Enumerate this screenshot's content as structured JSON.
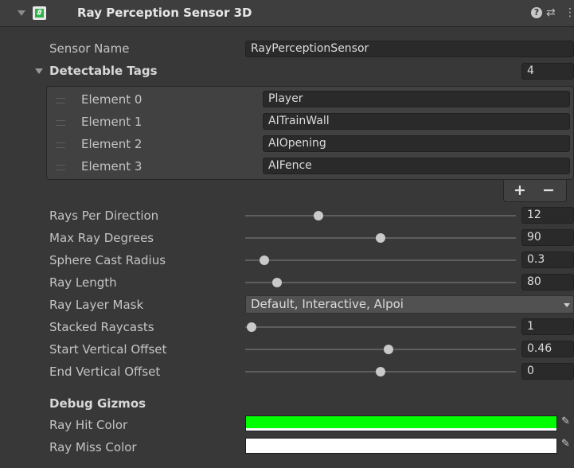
{
  "component": {
    "title": "Ray Perception Sensor 3D",
    "help_glyph": "?",
    "settings_glyph": "⇄",
    "menu_glyph": "⋮"
  },
  "sensor_name": {
    "label": "Sensor Name",
    "value": "RayPerceptionSensor"
  },
  "detectable_tags": {
    "label": "Detectable Tags",
    "count": "4",
    "elements": [
      {
        "label": "Element 0",
        "value": "Player"
      },
      {
        "label": "Element 1",
        "value": "AITrainWall"
      },
      {
        "label": "Element 2",
        "value": "AIOpening"
      },
      {
        "label": "Element 3",
        "value": "AIFence"
      }
    ],
    "add_label": "+",
    "remove_label": "−"
  },
  "sliders": [
    {
      "label": "Rays Per Direction",
      "value": "12",
      "fraction": 0.26
    },
    {
      "label": "Max Ray Degrees",
      "value": "90",
      "fraction": 0.5
    },
    {
      "label": "Sphere Cast Radius",
      "value": "0.3",
      "fraction": 0.05
    },
    {
      "label": "Ray Length",
      "value": "80",
      "fraction": 0.1
    }
  ],
  "layer_mask": {
    "label": "Ray Layer Mask",
    "value": "Default, Interactive, Alpoi"
  },
  "sliders2": [
    {
      "label": "Stacked Raycasts",
      "value": "1",
      "fraction": 0.0
    },
    {
      "label": "Start Vertical Offset",
      "value": "0.46",
      "fraction": 0.53
    },
    {
      "label": "End Vertical Offset",
      "value": "0",
      "fraction": 0.5
    }
  ],
  "debug": {
    "heading": "Debug Gizmos",
    "hit": {
      "label": "Ray Hit Color",
      "color": "#00ff00"
    },
    "miss": {
      "label": "Ray Miss Color",
      "color": "#ffffff"
    }
  }
}
